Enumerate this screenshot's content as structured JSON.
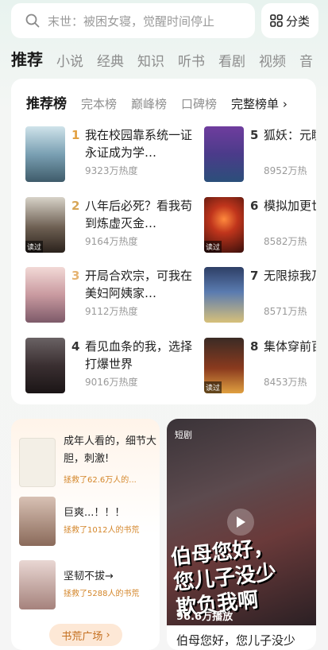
{
  "search": {
    "placeholder": "末世：被困女寝，觉醒时间停止",
    "category_label": "分类"
  },
  "tabs": [
    "推荐",
    "小说",
    "经典",
    "知识",
    "听书",
    "看剧",
    "视频",
    "音"
  ],
  "ranking": {
    "tabs": [
      "推荐榜",
      "完本榜",
      "巅峰榜",
      "口碑榜"
    ],
    "full_label": "完整榜单",
    "items": [
      {
        "rank": "1",
        "title": "我在校园靠系统一证永证成为学…",
        "heat": "9323万热度"
      },
      {
        "rank": "2",
        "title": "八年后必死？看我苟到炼虚灭金…",
        "heat": "9164万热度",
        "badge": "读过"
      },
      {
        "rank": "3",
        "title": "开局合欢宗，可我在美妇阿姨家…",
        "heat": "9112万热度"
      },
      {
        "rank": "4",
        "title": "看见血条的我，选择打爆世界",
        "heat": "9016万热度"
      },
      {
        "rank": "5",
        "title": "狐妖：元瞳，续",
        "heat": "8952万热"
      },
      {
        "rank": "6",
        "title": "模拟加更世已无",
        "heat": "8582万热",
        "badge": "读过"
      },
      {
        "rank": "7",
        "title": "无限掠我乃词",
        "heat": "8571万热"
      },
      {
        "rank": "8",
        "title": "集体穿前百年",
        "heat": "8453万热",
        "badge": "读过"
      }
    ]
  },
  "feed": {
    "items": [
      {
        "title": "成年人看的，细节大胆，刺激!",
        "sub": "拯救了62.6万人的..."
      },
      {
        "title": "巨爽...！！！",
        "sub": "拯救了1012人的书荒"
      },
      {
        "title": "坚韧不拔→",
        "sub": "拯救了5288人的书荒"
      }
    ],
    "button": "书荒广场"
  },
  "video": {
    "tag": "短剧",
    "caption": "伯母您好，\n您儿子没少\n欺负我啊",
    "plays": "96.6万播放",
    "title": "伯母您好，您儿子没少"
  }
}
